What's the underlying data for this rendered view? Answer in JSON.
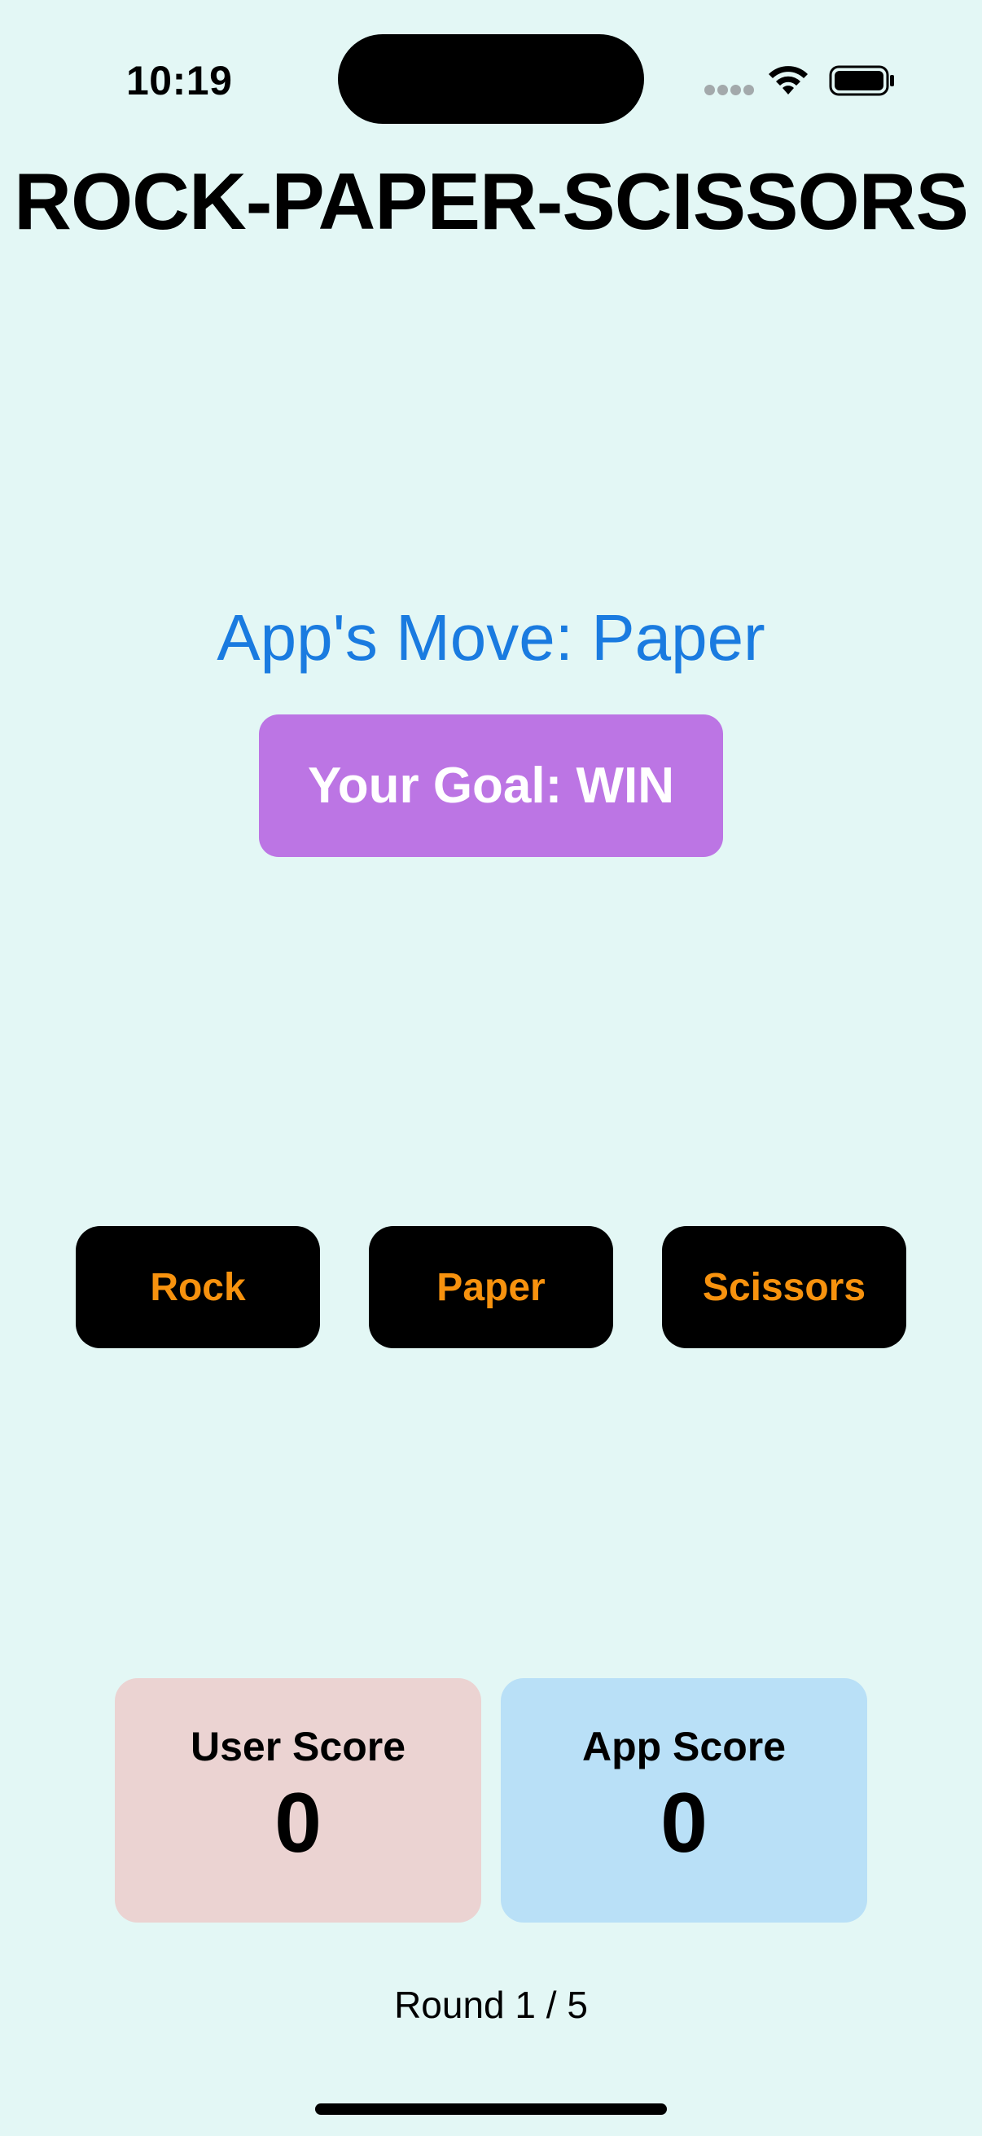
{
  "status_bar": {
    "time": "10:19"
  },
  "title": "ROCK-PAPER-SCISSORS",
  "app_move": {
    "label": "App's Move: Paper"
  },
  "goal": {
    "label": "Your Goal: WIN"
  },
  "choices": [
    {
      "label": "Rock"
    },
    {
      "label": "Paper"
    },
    {
      "label": "Scissors"
    }
  ],
  "scores": {
    "user": {
      "label": "User Score",
      "value": "0"
    },
    "app": {
      "label": "App Score",
      "value": "0"
    }
  },
  "round": {
    "text": "Round 1 / 5"
  },
  "colors": {
    "background": "#e3f7f5",
    "app_move_text": "#1a7be0",
    "goal_badge": "#bc75e4",
    "choice_button": "#000000",
    "choice_text": "#f7920e",
    "user_score_card": "#ebd3d2",
    "app_score_card": "#b9e0f7"
  },
  "icons": {
    "signal": "cellular-signal-icon",
    "wifi": "wifi-icon",
    "battery": "battery-icon"
  }
}
